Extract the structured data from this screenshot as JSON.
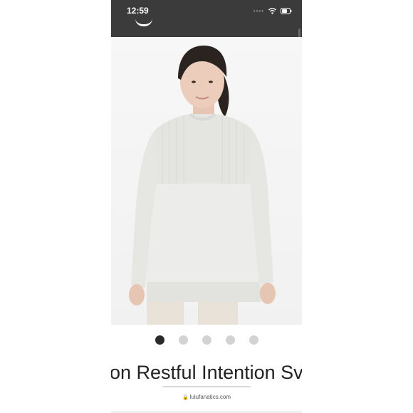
{
  "status_bar": {
    "time": "12:59",
    "signal_icon": "signal-dots-icon",
    "wifi_icon": "wifi-icon",
    "battery_icon": "battery-icon"
  },
  "product": {
    "image_alt": "model-wearing-white-sweater",
    "title": "on Restful Intention Sv",
    "carousel": {
      "count": 5,
      "active_index": 0
    }
  },
  "browser": {
    "url": "lulufanatics.com",
    "lock_icon": "lock-icon"
  },
  "colors": {
    "status_bar_bg": "#3b3b3b",
    "active_dot": "#2a2a2a",
    "inactive_dot": "#d3d3d3"
  }
}
